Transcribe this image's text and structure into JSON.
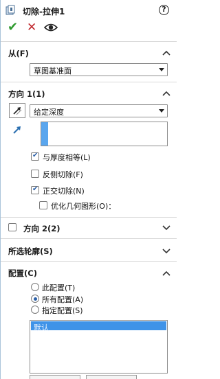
{
  "header": {
    "title": "切除-拉伸1",
    "help_icon": "help-icon",
    "feature_icon": "extrude-cut-icon"
  },
  "toolbar": {
    "ok_icon": "✔",
    "cancel_icon": "✕",
    "preview_icon": "eye-icon"
  },
  "from": {
    "title": "从(F)",
    "selected": "草图基准面"
  },
  "direction1": {
    "title": "方向 1(1)",
    "end_condition": "给定深度",
    "depth_value": "",
    "options": [
      {
        "label": "与厚度相等(L)",
        "checked": true
      },
      {
        "label": "反侧切除(F)",
        "checked": false
      },
      {
        "label": "正交切除(N)",
        "checked": true
      },
      {
        "label": "优化几何图形(O)：",
        "checked": false
      }
    ]
  },
  "direction2": {
    "title": "方向 2(2)",
    "checked": false
  },
  "selected_contours": {
    "title": "所选轮廓(S)"
  },
  "configuration": {
    "title": "配置(C)",
    "options": [
      {
        "label": "此配置(T)",
        "checked": false
      },
      {
        "label": "所有配置(A)",
        "checked": true
      },
      {
        "label": "指定配置(S)",
        "checked": false
      }
    ],
    "list_items": [
      "默认"
    ]
  },
  "colors": {
    "accent": "#3f93e8",
    "ok_green": "#2f9a2f",
    "cancel_red": "#c0282d"
  }
}
